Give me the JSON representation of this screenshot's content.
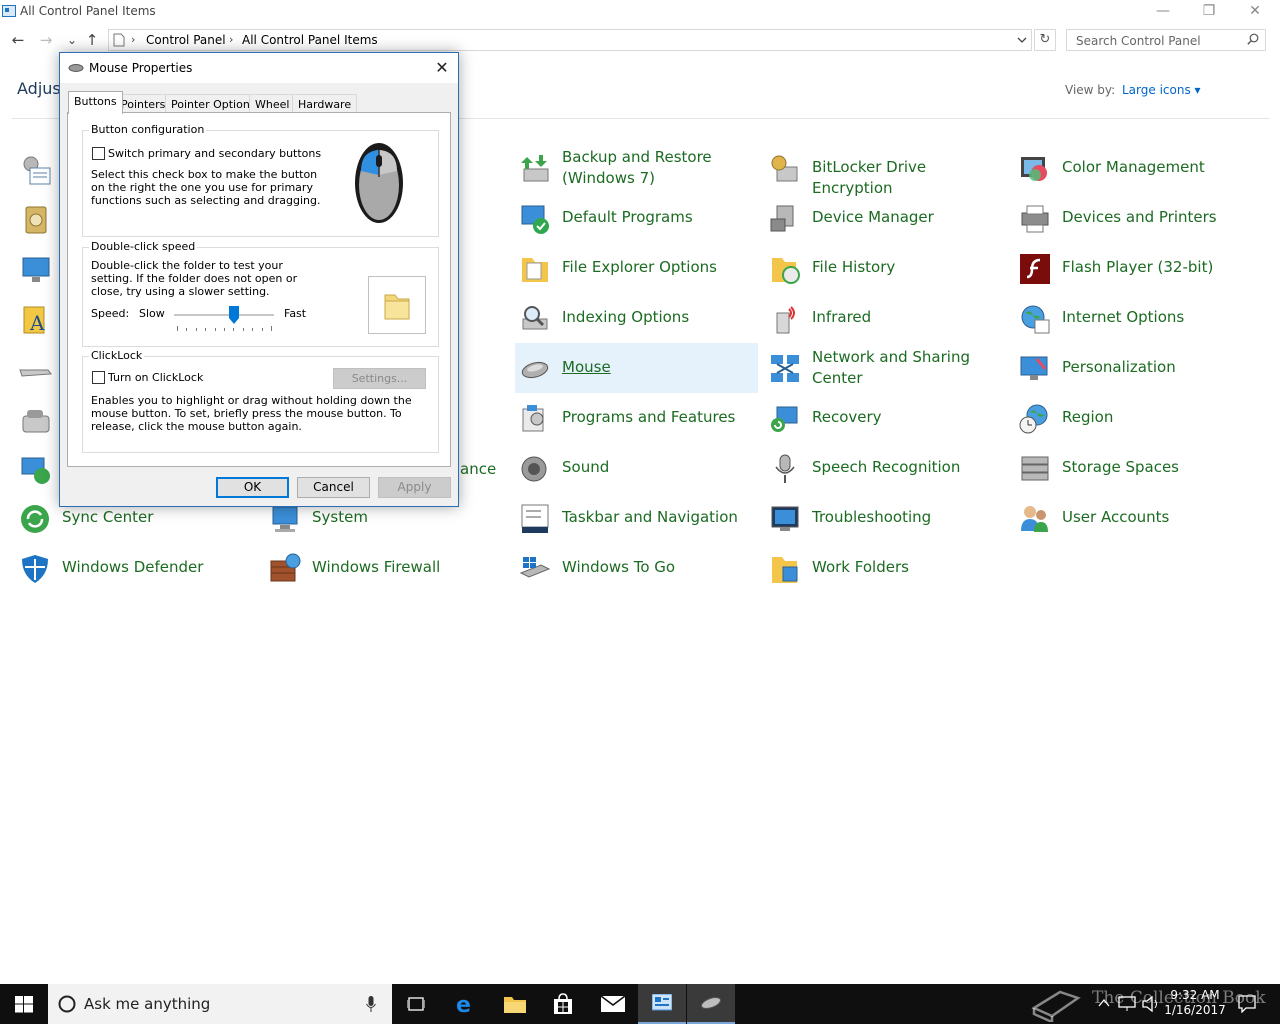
{
  "window": {
    "title": "All Control Panel Items",
    "minimize_glyph": "—",
    "maximize_glyph": "❐",
    "close_glyph": "✕"
  },
  "nav": {
    "back_glyph": "←",
    "forward_glyph": "→",
    "recent_glyph": "⌄",
    "up_glyph": "↑",
    "breadcrumb": [
      "Control Panel",
      "All Control Panel Items"
    ],
    "breadcrumb_sep": "›",
    "refresh_glyph": "↻",
    "search_placeholder": "Search Control Panel"
  },
  "page": {
    "heading_partial": "Adjust",
    "view_by_label": "View by:",
    "view_by_value": "Large icons ▾",
    "hidden_fragment": "ance"
  },
  "items": [
    {
      "label": "Backup and Restore (Windows 7)",
      "icon": "backup-restore-icon"
    },
    {
      "label": "BitLocker Drive Encryption",
      "icon": "bitlocker-icon"
    },
    {
      "label": "Color Management",
      "icon": "color-management-icon"
    },
    {
      "label": "Default Programs",
      "icon": "default-programs-icon"
    },
    {
      "label": "Device Manager",
      "icon": "device-manager-icon"
    },
    {
      "label": "Devices and Printers",
      "icon": "devices-printers-icon"
    },
    {
      "label": "File Explorer Options",
      "icon": "file-explorer-options-icon"
    },
    {
      "label": "File History",
      "icon": "file-history-icon"
    },
    {
      "label": "Flash Player (32-bit)",
      "icon": "flash-player-icon"
    },
    {
      "label": "Indexing Options",
      "icon": "indexing-options-icon"
    },
    {
      "label": "Infrared",
      "icon": "infrared-icon"
    },
    {
      "label": "Internet Options",
      "icon": "internet-options-icon"
    },
    {
      "label": "Mouse",
      "icon": "mouse-icon"
    },
    {
      "label": "Network and Sharing Center",
      "icon": "network-sharing-icon"
    },
    {
      "label": "Personalization",
      "icon": "personalization-icon"
    },
    {
      "label": "Programs and Features",
      "icon": "programs-features-icon"
    },
    {
      "label": "Recovery",
      "icon": "recovery-icon"
    },
    {
      "label": "Region",
      "icon": "region-icon"
    },
    {
      "label": "Sound",
      "icon": "sound-icon"
    },
    {
      "label": "Speech Recognition",
      "icon": "speech-recognition-icon"
    },
    {
      "label": "Storage Spaces",
      "icon": "storage-spaces-icon"
    },
    {
      "label": "Sync Center",
      "icon": "sync-center-icon"
    },
    {
      "label": "System",
      "icon": "system-icon"
    },
    {
      "label": "Taskbar and Navigation",
      "icon": "taskbar-navigation-icon"
    },
    {
      "label": "Troubleshooting",
      "icon": "troubleshooting-icon"
    },
    {
      "label": "User Accounts",
      "icon": "user-accounts-icon"
    },
    {
      "label": "Windows Defender",
      "icon": "windows-defender-icon"
    },
    {
      "label": "Windows Firewall",
      "icon": "windows-firewall-icon"
    },
    {
      "label": "Windows To Go",
      "icon": "windows-to-go-icon"
    },
    {
      "label": "Work Folders",
      "icon": "work-folders-icon"
    }
  ],
  "dialog": {
    "title": "Mouse Properties",
    "close_glyph": "✕",
    "tabs": [
      "Buttons",
      "Pointers",
      "Pointer Options",
      "Wheel",
      "Hardware"
    ],
    "active_tab": "Buttons",
    "button_config": {
      "legend": "Button configuration",
      "checkbox_label": "Switch primary and secondary buttons",
      "checked": false,
      "description": "Select this check box to make the button on the right the one you use for primary functions such as selecting and dragging."
    },
    "double_click": {
      "legend": "Double-click speed",
      "description": "Double-click the folder to test your setting. If the folder does not open or close, try using a slower setting.",
      "speed_label": "Speed:",
      "slow_label": "Slow",
      "fast_label": "Fast",
      "speed_fraction": 0.6
    },
    "clicklock": {
      "legend": "ClickLock",
      "checkbox_label": "Turn on ClickLock",
      "checked": false,
      "settings_label": "Settings...",
      "description": "Enables you to highlight or drag without holding down the mouse button. To set, briefly press the mouse button. To release, click the mouse button again."
    },
    "ok_label": "OK",
    "cancel_label": "Cancel",
    "apply_label": "Apply"
  },
  "taskbar": {
    "cortana_placeholder": "Ask me anything",
    "time": "9:32 AM",
    "date": "1/16/2017",
    "watermark": "The Collection Book"
  },
  "colors": {
    "link_green": "#1c6b22",
    "accent_blue": "#0078d7",
    "selected_bg": "#e5f1fb"
  }
}
